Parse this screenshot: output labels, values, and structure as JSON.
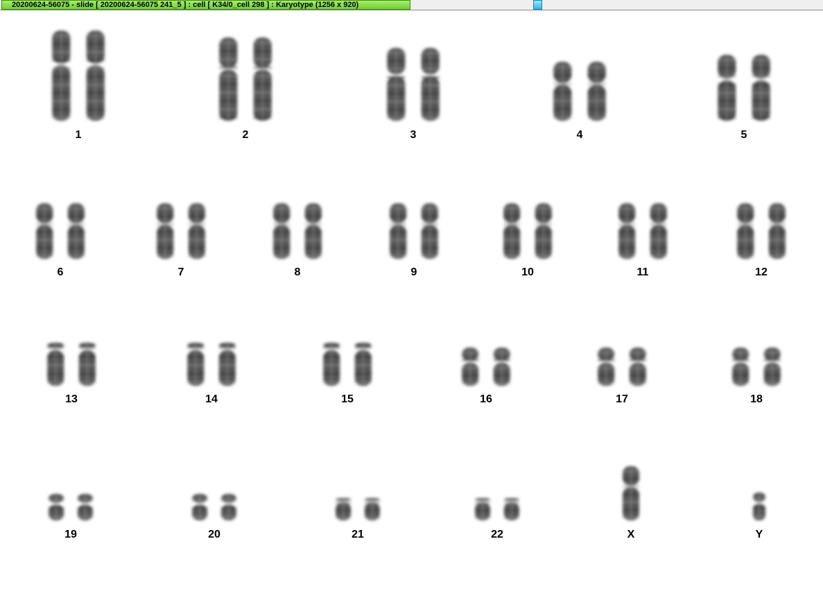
{
  "window": {
    "title": "20200624-56075 - slide [ 20200624-56075 241_5 ] : cell [ K34/0_cell 298 ] : Karyotype  (1256 x 920)"
  },
  "colors": {
    "title_bar_green": "#7ed63c",
    "scroll_handle_blue": "#28b8ea",
    "chromosome_gray": "#555555",
    "background": "#ffffff"
  },
  "karyotype": {
    "rows": [
      {
        "pairs": [
          {
            "label": "1",
            "length": "long"
          },
          {
            "label": "2",
            "length": "long"
          },
          {
            "label": "3",
            "length": "long"
          },
          {
            "label": "4",
            "length": "long"
          },
          {
            "label": "5",
            "length": "long"
          }
        ]
      },
      {
        "pairs": [
          {
            "label": "6",
            "length": "medium"
          },
          {
            "label": "7",
            "length": "medium"
          },
          {
            "label": "8",
            "length": "medium"
          },
          {
            "label": "9",
            "length": "medium"
          },
          {
            "label": "10",
            "length": "medium"
          },
          {
            "label": "11",
            "length": "medium"
          },
          {
            "label": "12",
            "length": "medium"
          }
        ]
      },
      {
        "pairs": [
          {
            "label": "13",
            "length": "acrocentric"
          },
          {
            "label": "14",
            "length": "acrocentric"
          },
          {
            "label": "15",
            "length": "acrocentric"
          },
          {
            "label": "16",
            "length": "short"
          },
          {
            "label": "17",
            "length": "short"
          },
          {
            "label": "18",
            "length": "short"
          }
        ]
      },
      {
        "pairs": [
          {
            "label": "19",
            "length": "tiny"
          },
          {
            "label": "20",
            "length": "tiny"
          },
          {
            "label": "21",
            "length": "acrocentric-small"
          },
          {
            "label": "22",
            "length": "acrocentric-small"
          },
          {
            "label": "X",
            "length": "single-medium"
          },
          {
            "label": "Y",
            "length": "single-small"
          }
        ]
      }
    ]
  }
}
